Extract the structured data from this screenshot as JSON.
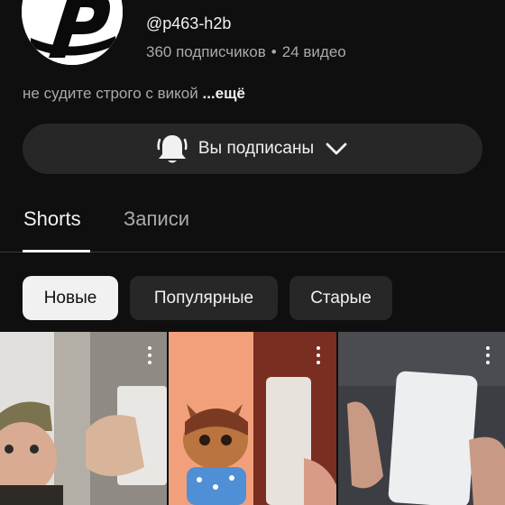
{
  "channel": {
    "handle": "@p463-h2b",
    "subscribers": "360 подписчиков",
    "separator": "•",
    "videos": "24 видео",
    "description": "не судите строго с викой",
    "more_label": "...ещё"
  },
  "subscribe_button": {
    "label": "Вы подписаны"
  },
  "tabs": [
    {
      "label": "Shorts",
      "selected": true
    },
    {
      "label": "Записи",
      "selected": false
    }
  ],
  "filters": [
    {
      "label": "Новые",
      "selected": true
    },
    {
      "label": "Популярные",
      "selected": false
    },
    {
      "label": "Старые",
      "selected": false
    }
  ],
  "shorts": [
    {
      "description": "man in cap with phone box"
    },
    {
      "description": "cartoon cat girl and phone"
    },
    {
      "description": "hand holding white phone"
    }
  ],
  "icons": [
    "channel-avatar-logo",
    "bell-icon",
    "chevron-down-icon",
    "more-vert-icon"
  ],
  "colors": {
    "background": "#0f0f0f",
    "surface": "#272727",
    "text_primary": "#f1f1f1",
    "text_secondary": "#aaaaaa"
  }
}
